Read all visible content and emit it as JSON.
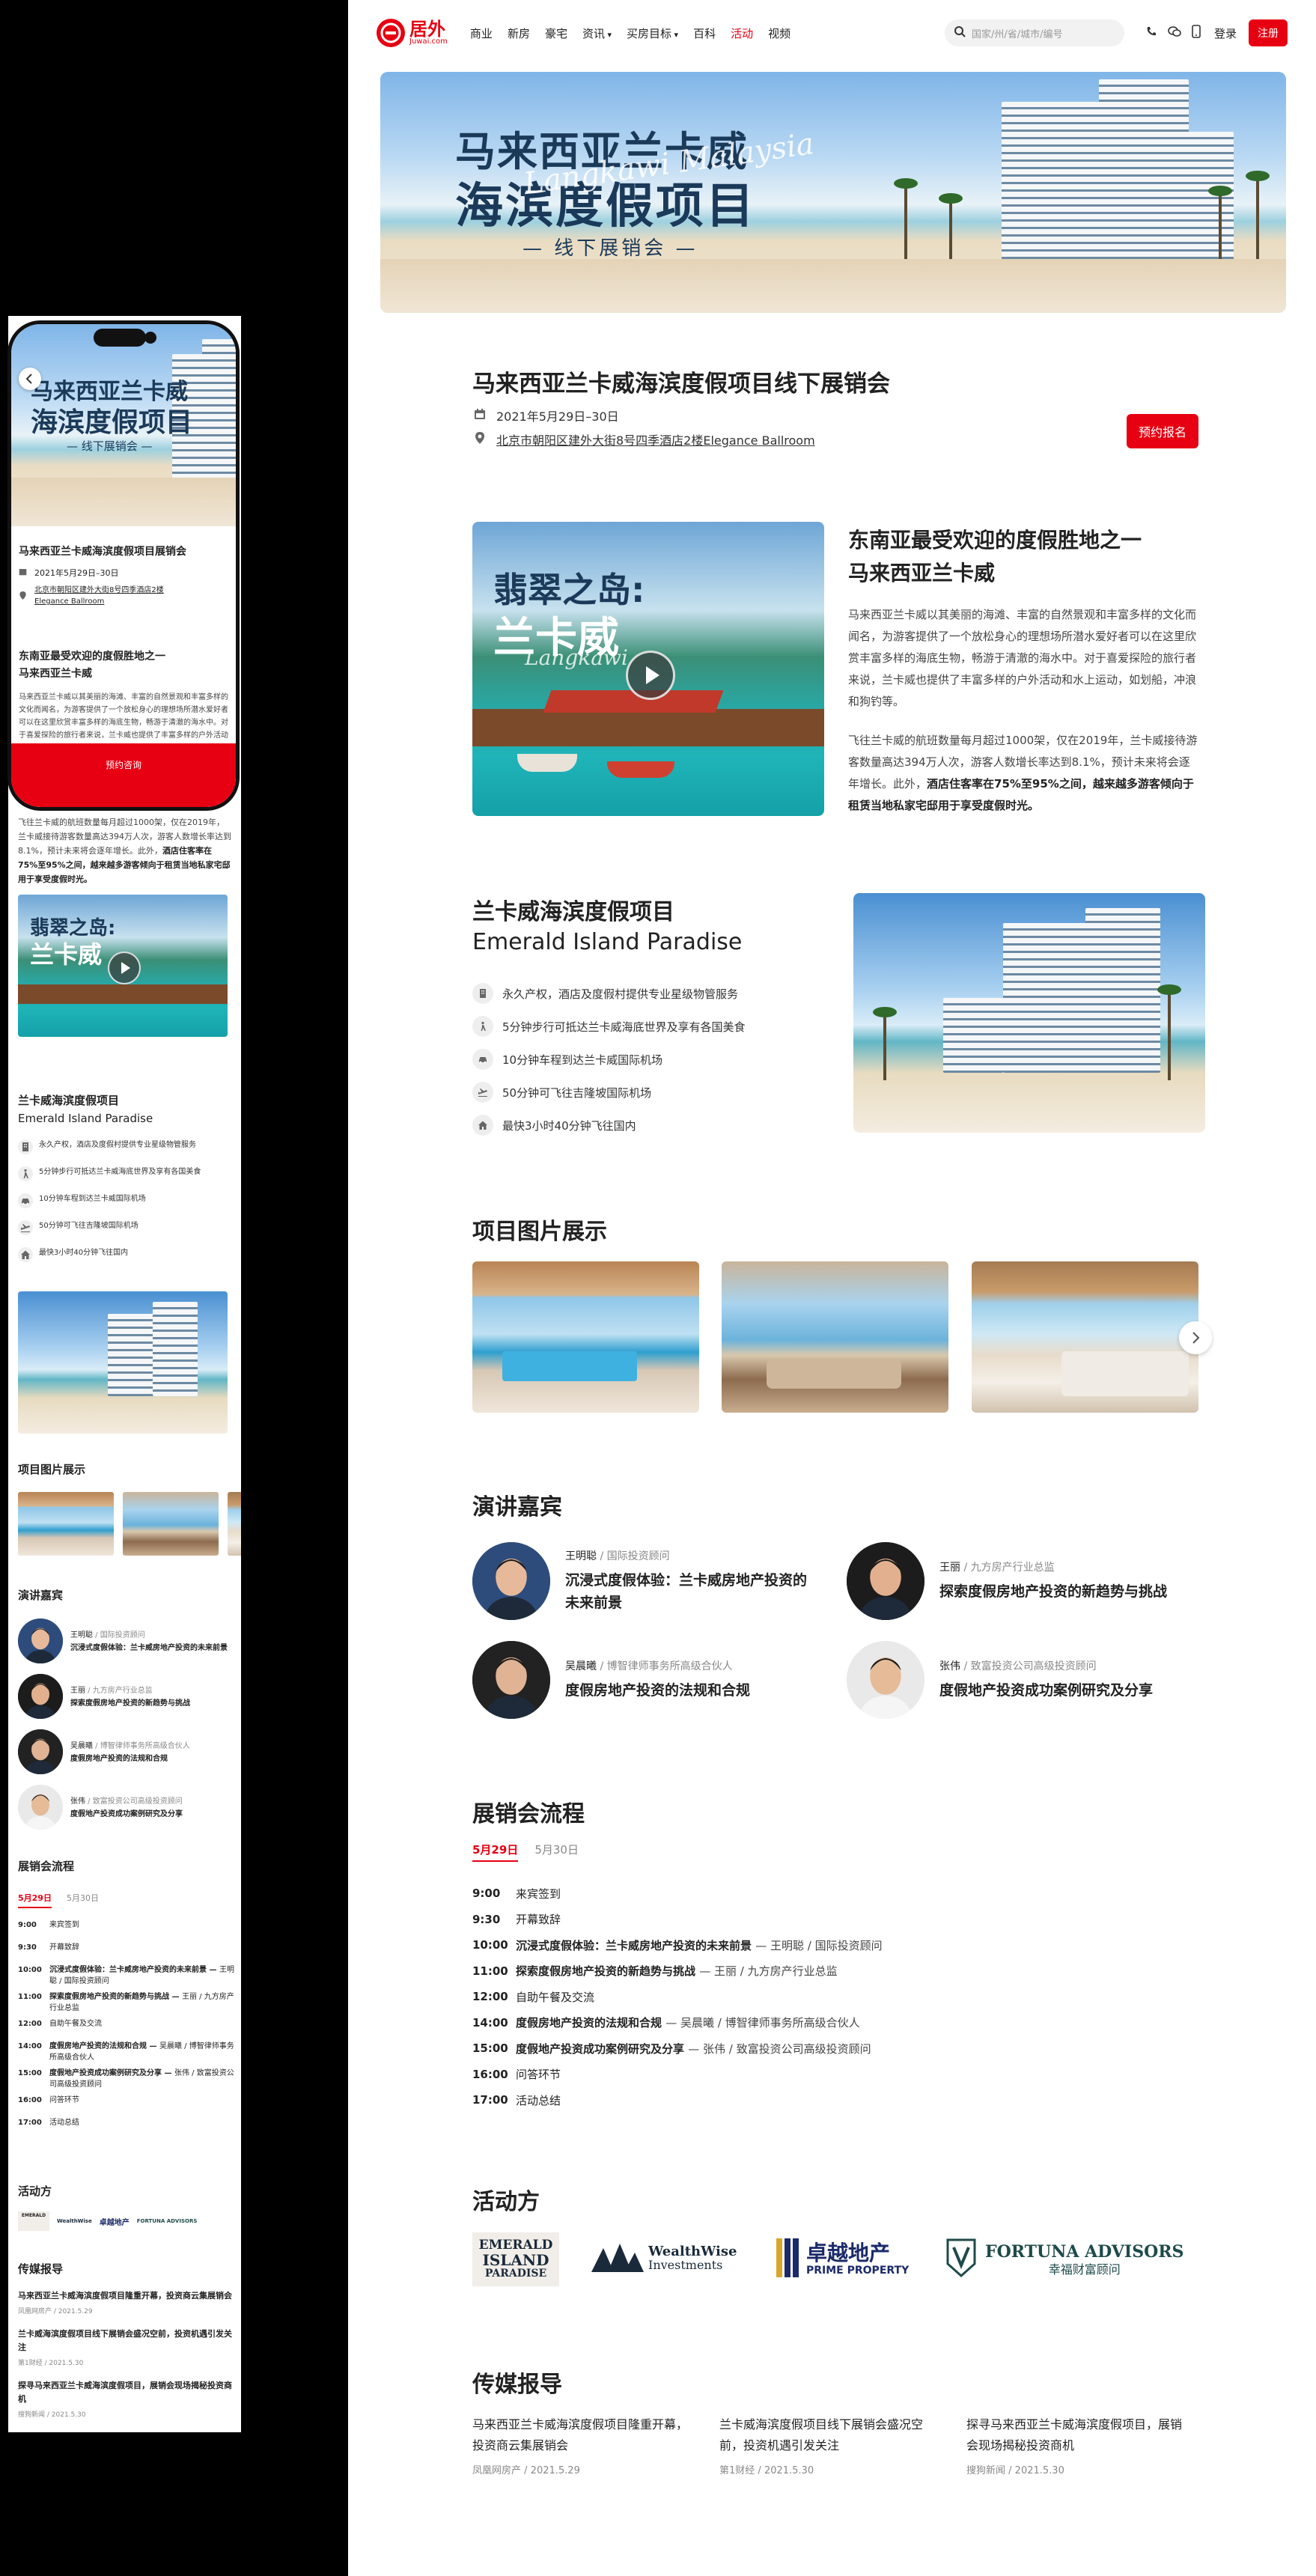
{
  "header": {
    "logo_text": "居外",
    "logo_sub": "Juwai.com",
    "nav": [
      "商业",
      "新房",
      "豪宅",
      "资讯",
      "买房目标",
      "百科",
      "活动",
      "视频"
    ],
    "nav_dropdown_flags": [
      false,
      false,
      false,
      true,
      true,
      false,
      false,
      false
    ],
    "active_nav": "活动",
    "search_placeholder": "国家/州/省/城市/编号",
    "login": "登录",
    "register": "注册"
  },
  "banner": {
    "title_line1": "马来西亚兰卡威",
    "title_line2": "海滨度假项目",
    "script_text": "Langkawi Malaysia",
    "subtitle": "— 线下展销会 —"
  },
  "event": {
    "title": "马来西亚兰卡威海滨度假项目线下展销会",
    "title_mobile": "马来西亚兰卡威海滨度假项目展销会",
    "date": "2021年5月29日–30日",
    "address": "北京市朝阳区建外大街8号四季酒店2楼Elegance Ballroom",
    "address_mobile_line1": "北京市朝阳区建外大街8号四季酒店2楼",
    "address_mobile_line2": "Elegance Ballroom",
    "register_button": "预约报名",
    "mobile_cta": "预约咨询"
  },
  "intro": {
    "video_title_line1": "翡翠之岛:",
    "video_title_line2": "兰卡威",
    "video_script": "Langkawi",
    "heading_line1": "东南亚最受欢迎的度假胜地之一",
    "heading_line2": "马来西亚兰卡威",
    "para1": "马来西亚兰卡威以其美丽的海滩、丰富的自然景观和丰富多样的文化而闻名，为游客提供了一个放松身心的理想场所潜水爱好者可以在这里欣赏丰富多样的海底生物，畅游于清澈的海水中。对于喜爱探险的旅行者来说，兰卡威也提供了丰富多样的户外活动和水上运动，如划船，冲浪和狗钓等。",
    "para2_part1": "飞往兰卡威的航班数量每月超过1000架，仅在2019年，兰卡威接待游客数量高达394万人次，游客人数增长率达到8.1%，预计未来将会逐年增长。此外，",
    "para2_bold": "酒店住客率在75%至95%之间，越来越多游客倾向于租赁当地私家宅邸用于享受度假时光。",
    "mobile_para1": "马来西亚兰卡威以其美丽的海滩、丰富的自然景观和丰富多样的文化而闻名，为游客提供了一个放松身心的理想场所潜水爱好者可以在这里欣赏丰富多样的海底生物，畅游于清澈的海水中。对于喜爱探险的旅行者来说，兰卡威也提供了丰富多样的户外活动和水上运动。",
    "mobile_para2_part1": "飞往兰卡威的航班数量每月超过1000架，仅在2019年，兰卡威接待游客数量高达394万人次，游客人数增长率达到8.1%，预计未来将会逐年增长。此外，",
    "mobile_para2_bold": "酒店住客率在75%至95%之间，越来越多游客倾向于租赁当地私家宅邸用于享受度假时光。"
  },
  "project": {
    "title_cn": "兰卡威海滨度假项目",
    "title_en": "Emerald Island Paradise",
    "features": [
      {
        "icon": "building-icon",
        "text": "永久产权，酒店及度假村提供专业星级物管服务"
      },
      {
        "icon": "walk-icon",
        "text": "5分钟步行可抵达兰卡威海底世界及享有各国美食"
      },
      {
        "icon": "car-icon",
        "text": "10分钟车程到达兰卡威国际机场"
      },
      {
        "icon": "plane-icon",
        "text": "50分钟可飞往吉隆坡国际机场"
      },
      {
        "icon": "home-icon",
        "text": "最快3小时40分钟飞往国内"
      }
    ]
  },
  "gallery": {
    "title": "项目图片展示",
    "images": [
      "room-pool-image",
      "living-room-image",
      "bedroom-image"
    ]
  },
  "speakers": {
    "title": "演讲嘉宾",
    "list": [
      {
        "name": "王明聪",
        "role": "国际投资顾问",
        "topic": "沉浸式度假体验：兰卡威房地产投资的未来前景"
      },
      {
        "name": "王丽",
        "role": "九方房产行业总监",
        "topic": "探索度假房地产投资的新趋势与挑战"
      },
      {
        "name": "吴晨曦",
        "role": "博智律师事务所高级合伙人",
        "topic": "度假房地产投资的法规和合规"
      },
      {
        "name": "张伟",
        "role": "致富投资公司高级投资顾问",
        "topic": "度假地产投资成功案例研究及分享"
      }
    ]
  },
  "schedule": {
    "title": "展销会流程",
    "tabs": [
      "5月29日",
      "5月30日"
    ],
    "active_tab": "5月29日",
    "items": [
      {
        "time": "9:00",
        "text": "来宾签到",
        "bold": false
      },
      {
        "time": "9:30",
        "text": "开幕致辞",
        "bold": false
      },
      {
        "time": "10:00",
        "text": "沉浸式度假体验：兰卡威房地产投资的未来前景",
        "who": "王明聪 / 国际投资顾问",
        "bold": true
      },
      {
        "time": "11:00",
        "text": "探索度假房地产投资的新趋势与挑战",
        "who": "王丽 / 九方房产行业总监",
        "bold": true
      },
      {
        "time": "12:00",
        "text": "自助午餐及交流",
        "bold": false
      },
      {
        "time": "14:00",
        "text": "度假房地产投资的法规和合规",
        "who": "吴晨曦 / 博智律师事务所高级合伙人",
        "bold": true
      },
      {
        "time": "15:00",
        "text": "度假地产投资成功案例研究及分享",
        "who": "张伟 / 致富投资公司高级投资顾问",
        "bold": true
      },
      {
        "time": "16:00",
        "text": "问答环节",
        "bold": false
      },
      {
        "time": "17:00",
        "text": "活动总结",
        "bold": false
      }
    ]
  },
  "organizers": {
    "title": "活动方",
    "logos": [
      {
        "line1": "EMERALD",
        "line2": "ISLAND",
        "line3": "PARADISE"
      },
      {
        "line1": "WealthWise",
        "line2": "Investments"
      },
      {
        "line1": "卓越地产",
        "line2": "PRIME PROPERTY"
      },
      {
        "line1": "FORTUNA ADVISORS",
        "line2": "幸福财富顾问"
      }
    ]
  },
  "media": {
    "title": "传媒报导",
    "list": [
      {
        "title": "马来西亚兰卡威海滨度假项目隆重开幕，投资商云集展销会",
        "source": "凤凰网房产",
        "date": "2021.5.29"
      },
      {
        "title": "兰卡威海滨度假项目线下展销会盛况空前，投资机遇引发关注",
        "source": "第1财经",
        "date": "2021.5.30"
      },
      {
        "title": "探寻马来西亚兰卡威海滨度假项目，展销会现场揭秘投资商机",
        "source": "搜狗新闻",
        "date": "2021.5.30"
      }
    ]
  },
  "colors": {
    "accent": "#e60012",
    "text": "#222222",
    "muted": "#888888"
  }
}
